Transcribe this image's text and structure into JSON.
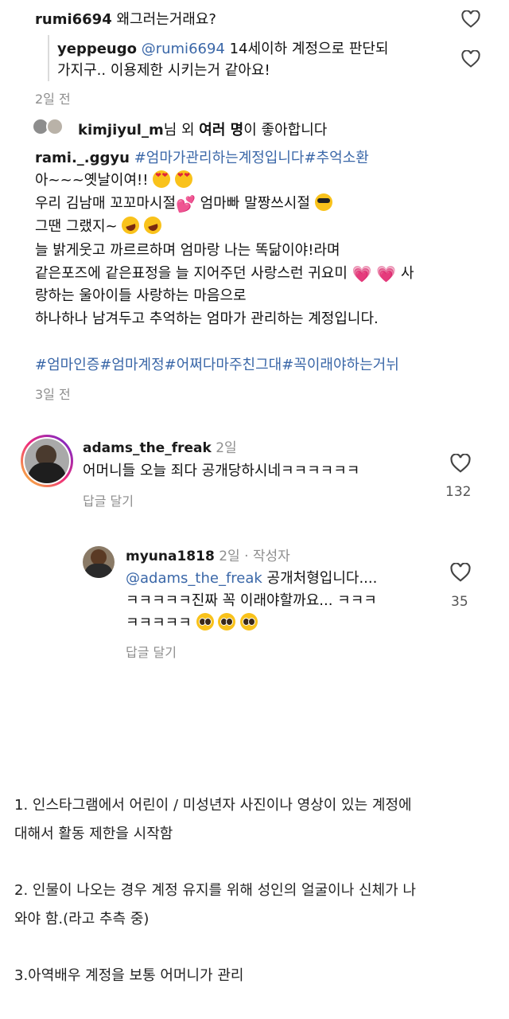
{
  "top_comment": {
    "username": "rumi6694",
    "text": "왜그러는거래요?"
  },
  "quoted_reply": {
    "username": "yeppeugo",
    "mention": "@rumi6694",
    "text_line1": "14세이하 계정으로 판단되",
    "text_line2": "가지구.. 이용제한 시키는거 같아요!"
  },
  "top_time": "2일 전",
  "liked_by": {
    "user": "kimjiyul_m",
    "mid": "님 외 ",
    "bold": "여러 명",
    "tail": "이 좋아합니다"
  },
  "caption": {
    "username": "rami._.ggyu",
    "hashtags_inline": "#엄마가관리하는계정입니다#추억소환",
    "line1": "아~~~옛날이여!!",
    "line2a": "우리 김남매 꼬꼬마시절",
    "line2b": " 엄마빠 말짱쓰시절",
    "line3": "그땐 그랬지~",
    "line4": "늘 밝게웃고 까르르하며 엄마랑 나는 똑닮이야!라며",
    "line5a": "같은포즈에 같은표정을 늘 지어주던 사랑스런 귀요미",
    "line5b": " 사",
    "line6": "랑하는 울아이들 사랑하는 마음으로",
    "line7": "하나하나 남겨두고 추억하는 엄마가 관리하는 계정입니다.",
    "hashtags_bottom": "#엄마인증#엄마계정#어쩌다마주친그대#꼭이래야하는거뉘",
    "time": "3일 전"
  },
  "comment1": {
    "username": "adams_the_freak",
    "time": "2일",
    "text": "어머니들 오늘 죄다 공개당하시네ㅋㅋㅋㅋㅋㅋ",
    "reply_label": "답글 달기",
    "likes": "132"
  },
  "comment2": {
    "username": "myuna1818",
    "time": "2일 · 작성자",
    "mention": "@adams_the_freak",
    "text1": " 공개처형입니다....",
    "text2": "ㅋㅋㅋㅋㅋ진짜 꼭 이래야할까요... ㅋㅋㅋ",
    "text3": "ㅋㅋㅋㅋㅋ",
    "reply_label": "답글 달기",
    "likes": "35"
  },
  "notes": {
    "item1_line1": "1. 인스타그램에서 어린이 / 미성년자 사진이나 영상이 있는 계정에",
    "item1_line2": "대해서 활동 제한을 시작함",
    "item2_line1": "2. 인물이 나오는 경우 계정 유지를 위해 성인의 얼굴이나 신체가 나",
    "item2_line2": "와야 함.(라고 추측 중)",
    "item3": "3.아역배우 계정을 보통 어머니가 관리"
  },
  "icons": {
    "like": "heart-outline-icon",
    "emoji_heart_eyes": "heart-eyes-emoji",
    "emoji_sunglasses": "sunglasses-emoji",
    "emoji_laugh": "rolling-laughing-emoji",
    "emoji_sparkle_heart": "sparkling-heart-emoji",
    "emoji_plead": "pleading-face-emoji"
  },
  "colors": {
    "link": "#3a67a8",
    "meta": "#8e8e8e"
  }
}
